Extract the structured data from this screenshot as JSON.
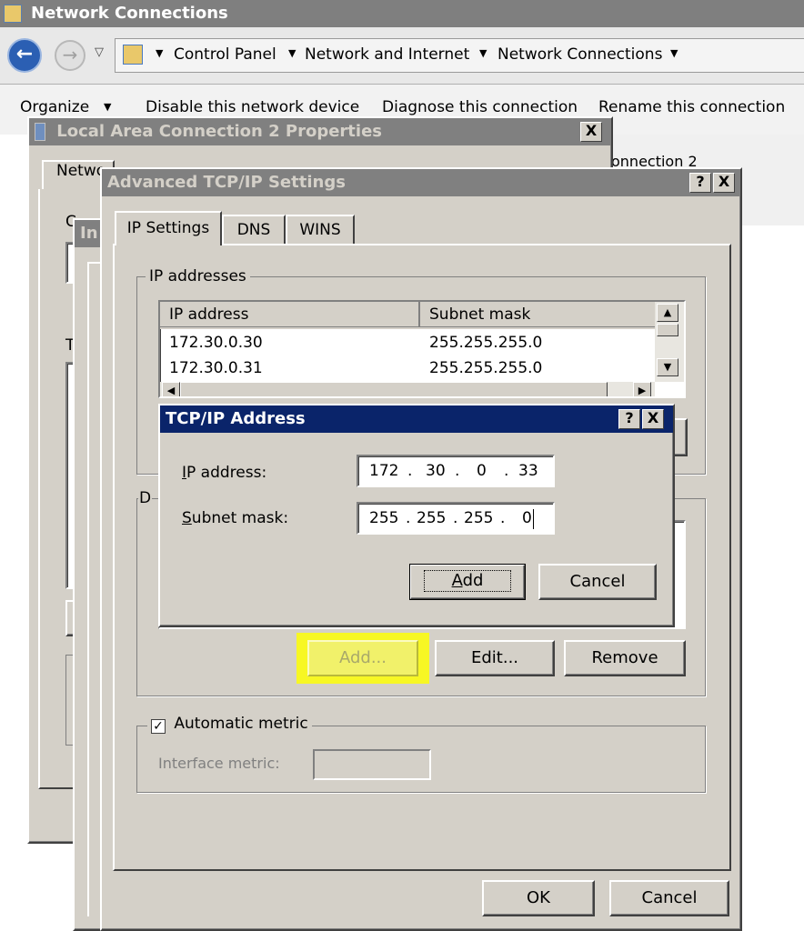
{
  "explorer": {
    "title": "Network Connections",
    "breadcrumb": [
      "Control Panel",
      "Network and Internet",
      "Network Connections"
    ],
    "toolbar": [
      "Organize",
      "Disable this network device",
      "Diagnose this connection",
      "Rename this connection"
    ],
    "right_fragment": "onnection 2"
  },
  "lac_dialog": {
    "title": "Local Area Connection 2 Properties",
    "tab_fragment": "Netwo",
    "close_label": "X",
    "frag_c": "C",
    "frag_t": "T"
  },
  "ipv4_dialog": {
    "title_fragment": "In"
  },
  "advanced": {
    "title": "Advanced TCP/IP Settings",
    "help_label": "?",
    "close_label": "X",
    "tabs": [
      "IP Settings",
      "DNS",
      "WINS"
    ],
    "ip_group_label": "IP addresses",
    "columns": [
      "IP address",
      "Subnet mask"
    ],
    "rows": [
      {
        "ip": "172.30.0.30",
        "mask": "255.255.255.0"
      },
      {
        "ip": "172.30.0.31",
        "mask": "255.255.255.0"
      }
    ],
    "gw_group_fragment": "D",
    "buttons": {
      "add": "Add...",
      "edit": "Edit...",
      "remove": "Remove"
    },
    "automatic_metric_label": "Automatic metric",
    "automatic_metric_checked": true,
    "interface_metric_label": "Interface metric:",
    "interface_metric_value": "",
    "ok": "OK",
    "cancel": "Cancel",
    "highlight_color": "#f7f724"
  },
  "tcpip": {
    "title": "TCP/IP Address",
    "help_label": "?",
    "close_label": "X",
    "ip_label": "IP address:",
    "ip_label_accel": "I",
    "ip_label_rest": "P address:",
    "ip_octets": [
      "172",
      "30",
      "0",
      "33"
    ],
    "mask_label": "Subnet mask:",
    "mask_label_accel": "S",
    "mask_label_rest": "ubnet mask:",
    "mask_octets": [
      "255",
      "255",
      "255",
      "0"
    ],
    "add_accel": "A",
    "add_rest": "dd",
    "cancel": "Cancel"
  },
  "colors": {
    "active_title": "#0a246a",
    "inactive_title": "#808080",
    "face": "#d4d0c8"
  }
}
